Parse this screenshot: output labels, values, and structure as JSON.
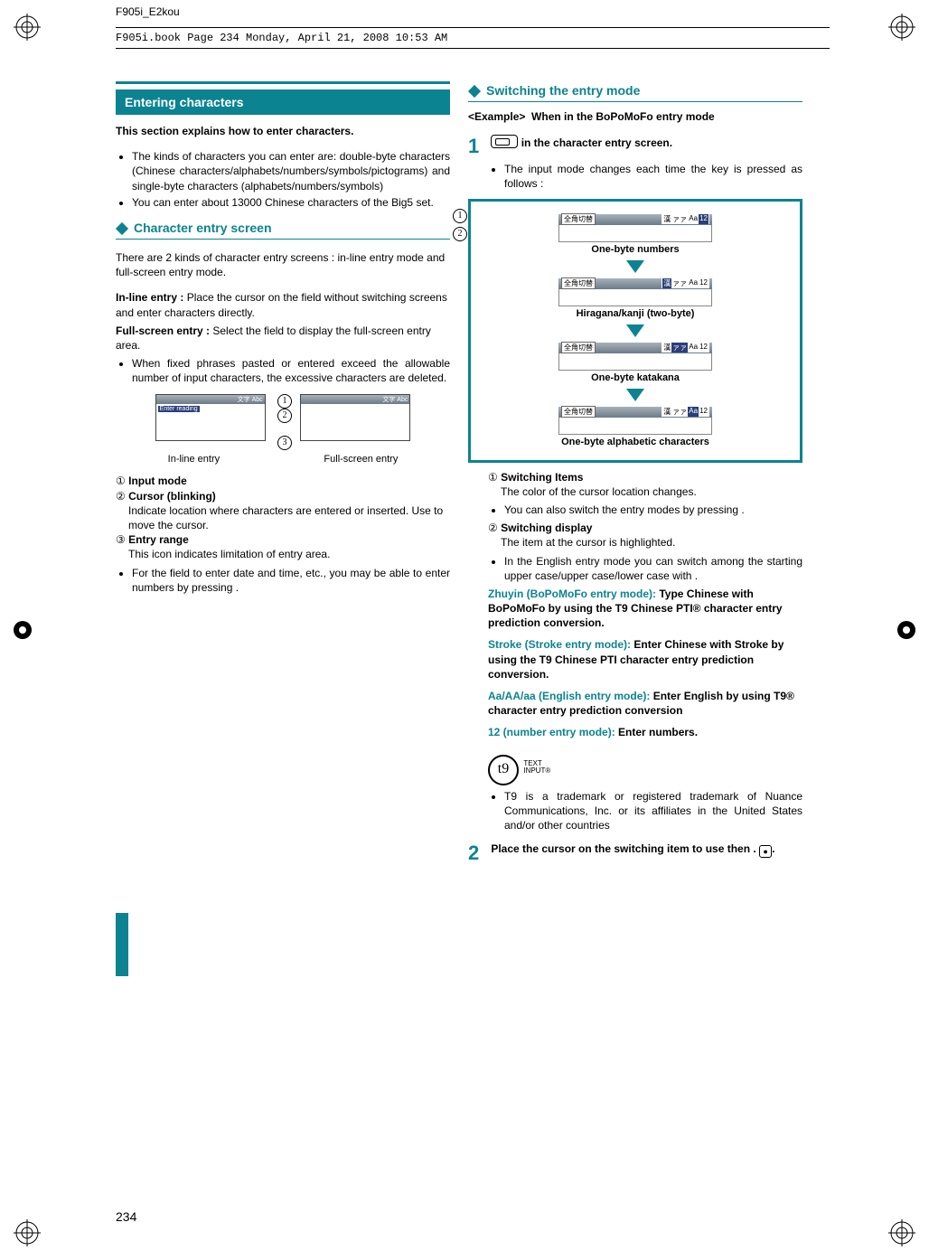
{
  "doc_header": "F905i_E2kou",
  "book_line": "F905i.book  Page 234  Monday, April 21, 2008  10:53 AM",
  "page_number": "234",
  "left": {
    "title": "Entering characters",
    "intro": "This section explains how to enter characters.",
    "bullets_intro": [
      "The kinds of characters you can enter are: double-byte characters (Chinese characters/alphabets/numbers/symbols/pictograms) and single-byte characters (alphabets/numbers/symbols)",
      "You can enter about 13000 Chinese characters of the Big5 set."
    ],
    "sub1_title": "Character entry screen",
    "sub1_para": "There are 2 kinds of character entry screens : in-line entry mode and full-screen entry mode.",
    "defs": [
      {
        "term": "In-line entry : ",
        "text": "Place the cursor on the field without switching screens and enter characters directly."
      },
      {
        "term": "Full-screen entry : ",
        "text": "Select the field to display the full-screen entry area."
      }
    ],
    "bullet_after_defs": "When fixed phrases pasted or entered exceed the allowable number of input characters, the excessive characters are deleted.",
    "diagram": {
      "titlebar_text_1": "文字    Abc",
      "enter_reading": "Enter reading",
      "titlebar_text_2": "文字    Abc",
      "label_inline": "In-line entry",
      "label_full": "Full-screen entry"
    },
    "circle_defs": [
      {
        "num": "①",
        "term": "Input mode",
        "text": ""
      },
      {
        "num": "②",
        "term": "Cursor (blinking)",
        "text": "Indicate location where characters are entered or inserted. Use     to move the cursor."
      },
      {
        "num": "③",
        "term": "Entry range",
        "text": "This icon indicates limitation of entry area."
      }
    ],
    "final_bullet": "For the field to enter date and time, etc., you may be able to enter numbers by pressing      ."
  },
  "right": {
    "sub_title": "Switching the entry mode",
    "example_label": "<Example>",
    "example_text": "When in the BoPoMoFo entry mode",
    "step1_text": " in the character entry screen.",
    "step1_bullet": "The input mode changes each time the key is pressed as follows :",
    "diagram_labels": {
      "jp_switch": "全角切替",
      "mode_chars": [
        "漢",
        "ァァ",
        "Aa",
        "12"
      ],
      "l1": "One-byte numbers",
      "l2": "Hiragana/kanji (two-byte)",
      "l3": "One-byte katakana",
      "l4": "One-byte alphabetic characters"
    },
    "circle_defs": [
      {
        "num": "①",
        "term": "Switching Items",
        "text": "The color of the cursor location changes."
      },
      {
        "num": "②",
        "term": "Switching display",
        "text": "The item at the cursor is highlighted."
      }
    ],
    "between_bullet": "You can also switch the entry modes by pressing     .",
    "after_bullet": "In the English entry mode you can switch among the starting upper case/upper case/lower case with      .",
    "modes": [
      {
        "label": "Zhuyin (BoPoMoFo entry mode): ",
        "text": "Type Chinese with BoPoMoFo by using the T9 Chinese PTI® character entry prediction conversion."
      },
      {
        "label": "Stroke (Stroke entry mode): ",
        "text": "Enter Chinese with Stroke by using the T9 Chinese PTI character entry prediction conversion."
      },
      {
        "label": "Aa/AA/aa (English entry mode): ",
        "text": "Enter English by using T9® character entry prediction conversion"
      },
      {
        "label": "12 (number entry mode): ",
        "text": "Enter numbers."
      }
    ],
    "t9_text": "t9",
    "t9_small1": "TEXT",
    "t9_small2": "INPUT®",
    "t9_bullet": "T9 is a trademark or registered trademark of Nuance Communications, Inc. or its affiliates in the United States and/or other countries",
    "step2_text": "Place the cursor on the switching item to use then     ."
  }
}
